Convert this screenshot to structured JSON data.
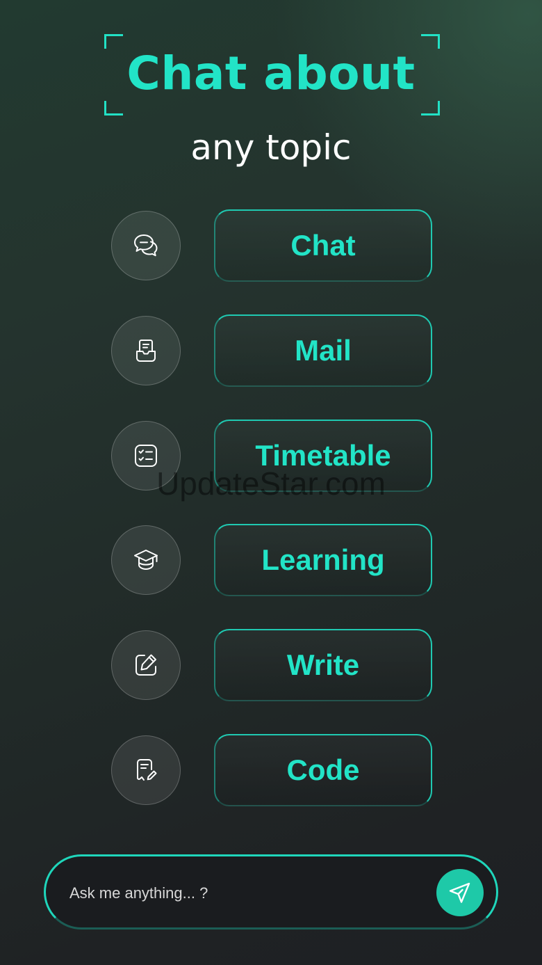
{
  "header": {
    "title": "Chat about",
    "subtitle": "any topic"
  },
  "topics": [
    {
      "label": "Chat",
      "icon": "chat-bubbles-icon"
    },
    {
      "label": "Mail",
      "icon": "mail-inbox-icon"
    },
    {
      "label": "Timetable",
      "icon": "checklist-icon"
    },
    {
      "label": "Learning",
      "icon": "graduation-cap-icon"
    },
    {
      "label": "Write",
      "icon": "edit-pencil-icon"
    },
    {
      "label": "Code",
      "icon": "document-pen-icon"
    }
  ],
  "watermark": "UpdateStar.com",
  "ask": {
    "placeholder": "Ask me anything... ?",
    "send_icon": "send-icon"
  },
  "colors": {
    "accent": "#22e4c7",
    "send_button": "#1ec9a8"
  }
}
